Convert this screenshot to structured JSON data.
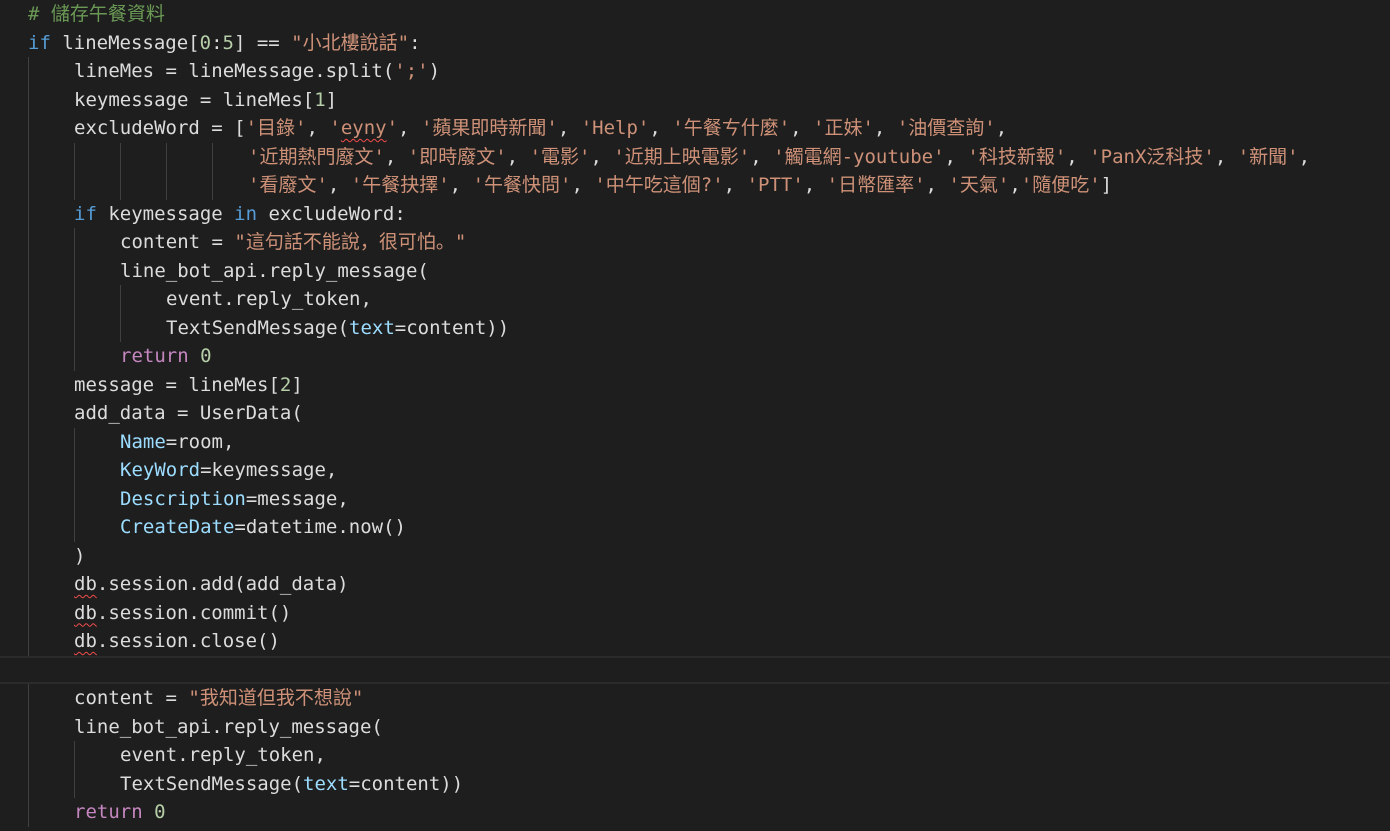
{
  "editor": {
    "theme_colors": {
      "background": "#1e1e1e",
      "comment": "#6a9955",
      "keyword": "#569cd6",
      "control": "#c586c0",
      "string": "#ce9178",
      "number": "#b5cea8",
      "identifier": "#dcdcdc",
      "parameter": "#9cdcfe",
      "error_squiggle": "#f14c4c"
    },
    "lines": [
      {
        "segments": [
          "# 儲存午餐資料"
        ]
      },
      {
        "segments": [
          "if",
          " lineMessage[",
          "0",
          ":",
          "5",
          "] == ",
          "\"小北樓說話\"",
          ":"
        ]
      },
      {
        "segments": [
          "lineMes = lineMessage.split(",
          "';'",
          ")"
        ]
      },
      {
        "segments": [
          "keymessage = lineMes[",
          "1",
          "]"
        ]
      },
      {
        "segments": [
          "excludeWord = [",
          "'目錄'",
          ", ",
          "'",
          "eyny",
          "'",
          ", ",
          "'蘋果即時新聞'",
          ", ",
          "'Help'",
          ", ",
          "'午餐ㄘ什麼'",
          ", ",
          "'正妹'",
          ", ",
          "'油價查詢'",
          ","
        ]
      },
      {
        "segments": [
          "'近期熱門廢文'",
          ", ",
          "'即時廢文'",
          ", ",
          "'電影'",
          ", ",
          "'近期上映電影'",
          ", ",
          "'觸電網-youtube'",
          ", ",
          "'科技新報'",
          ", ",
          "'PanX泛科技'",
          ", ",
          "'新聞'",
          ","
        ]
      },
      {
        "segments": [
          "'看廢文'",
          ", ",
          "'午餐抉擇'",
          ", ",
          "'午餐快問'",
          ", ",
          "'中午吃這個?'",
          ", ",
          "'PTT'",
          ", ",
          "'日幣匯率'",
          ", ",
          "'天氣'",
          ",",
          "'隨便吃'",
          "]"
        ]
      },
      {
        "segments": [
          "if",
          " keymessage ",
          "in",
          " excludeWord:"
        ]
      },
      {
        "segments": [
          "content = ",
          "\"這句話不能說，很可怕。\""
        ]
      },
      {
        "segments": [
          "line_bot_api.reply_message("
        ]
      },
      {
        "segments": [
          "event.reply_token,"
        ]
      },
      {
        "segments": [
          "TextSendMessage(",
          "text",
          "=content))"
        ]
      },
      {
        "segments": [
          "return",
          " ",
          "0"
        ]
      },
      {
        "segments": [
          "message = lineMes[",
          "2",
          "]"
        ]
      },
      {
        "segments": [
          "add_data = UserData("
        ]
      },
      {
        "segments": [
          "Name",
          "=room,"
        ]
      },
      {
        "segments": [
          "KeyWord",
          "=keymessage,"
        ]
      },
      {
        "segments": [
          "Description",
          "=message,"
        ]
      },
      {
        "segments": [
          "CreateDate",
          "=datetime.now()"
        ]
      },
      {
        "segments": [
          ")"
        ]
      },
      {
        "segments": [
          "db",
          ".session.add(add_data)"
        ]
      },
      {
        "segments": [
          "db",
          ".session.commit()"
        ]
      },
      {
        "segments": [
          "db",
          ".session.close()"
        ]
      },
      {
        "segments": [
          ""
        ]
      },
      {
        "segments": [
          "content = ",
          "\"我知道但我不想說\""
        ]
      },
      {
        "segments": [
          "line_bot_api.reply_message("
        ]
      },
      {
        "segments": [
          "event.reply_token,"
        ]
      },
      {
        "segments": [
          "TextSendMessage(",
          "text",
          "=content))"
        ]
      },
      {
        "segments": [
          "return",
          " ",
          "0"
        ]
      }
    ]
  }
}
